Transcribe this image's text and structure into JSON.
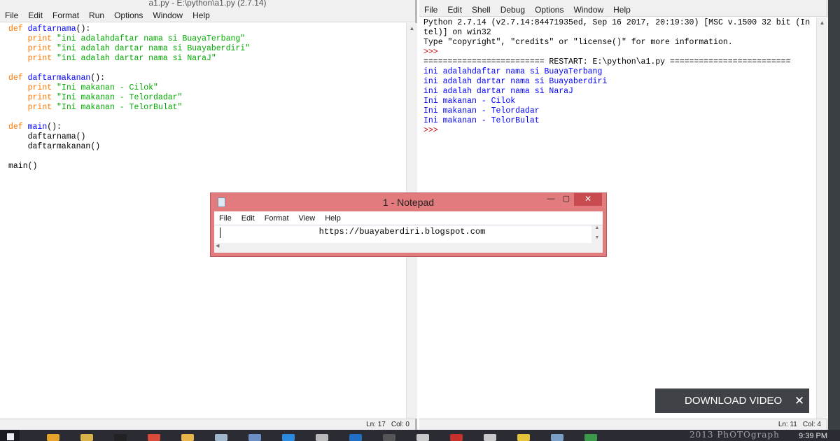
{
  "editor": {
    "title": "a1.py - E:\\python\\a1.py (2.7.14)",
    "menu": [
      "File",
      "Edit",
      "Format",
      "Run",
      "Options",
      "Window",
      "Help"
    ],
    "code": [
      {
        "kw": "def ",
        "fn": "daftarnama",
        "rest": "():"
      },
      {
        "indent": "    ",
        "kw": "print ",
        "str": "\"ini adalahdaftar nama si BuayaTerbang\""
      },
      {
        "indent": "    ",
        "kw": "print ",
        "str": "\"ini adalah dartar nama si Buayaberdiri\""
      },
      {
        "indent": "    ",
        "kw": "print ",
        "str": "\"ini adalah dartar nama si NaraJ\""
      },
      {},
      {
        "kw": "def ",
        "fn": "daftarmakanan",
        "rest": "():"
      },
      {
        "indent": "    ",
        "kw": "print ",
        "str": "\"Ini makanan - Cilok\""
      },
      {
        "indent": "    ",
        "kw": "print ",
        "str": "\"Ini makanan - Telordadar\""
      },
      {
        "indent": "    ",
        "kw": "print ",
        "str": "\"Ini makanan - TelorBulat\""
      },
      {},
      {
        "kw": "def ",
        "fn": "main",
        "rest": "():"
      },
      {
        "indent": "    ",
        "rest": "daftarnama()"
      },
      {
        "indent": "    ",
        "rest": "daftarmakanan()"
      },
      {},
      {
        "rest": "main()"
      }
    ],
    "status_ln": "Ln: 17",
    "status_col": "Col: 0"
  },
  "shell": {
    "menu": [
      "File",
      "Edit",
      "Shell",
      "Debug",
      "Options",
      "Window",
      "Help"
    ],
    "lines": [
      {
        "t": "Python 2.7.14 (v2.7.14:84471935ed, Sep 16 2017, 20:19:30) [MSC v.1500 32 bit (In",
        "c": "out"
      },
      {
        "t": "tel)] on win32",
        "c": "out"
      },
      {
        "t": "Type \"copyright\", \"credits\" or \"license()\" for more information.",
        "c": "out"
      },
      {
        "t": ">>> ",
        "c": "prompt"
      },
      {
        "t": "========================= RESTART: E:\\python\\a1.py =========================",
        "c": "out"
      },
      {
        "t": "ini adalahdaftar nama si BuayaTerbang",
        "c": "blue"
      },
      {
        "t": "ini adalah dartar nama si Buayaberdiri",
        "c": "blue"
      },
      {
        "t": "ini adalah dartar nama si NaraJ",
        "c": "blue"
      },
      {
        "t": "Ini makanan - Cilok",
        "c": "blue"
      },
      {
        "t": "Ini makanan - Telordadar",
        "c": "blue"
      },
      {
        "t": "Ini makanan - TelorBulat",
        "c": "blue"
      },
      {
        "t": ">>> ",
        "c": "prompt"
      }
    ],
    "status_ln": "Ln: 11",
    "status_col": "Col: 4"
  },
  "notepad": {
    "title": "1 - Notepad",
    "menu": [
      "File",
      "Edit",
      "Format",
      "View",
      "Help"
    ],
    "content": "https://buayaberdiri.blogspot.com",
    "accent": "#e27b7d"
  },
  "download_banner": {
    "label": "DOWNLOAD VIDEO",
    "close": "✕"
  },
  "taskbar": {
    "clock": "9:39 PM",
    "watermark": "2013 PhOTOgraph",
    "items": [
      {
        "name": "file-explorer-icon",
        "color": "#e6a42a"
      },
      {
        "name": "folder-icon",
        "color": "#d9b24a"
      },
      {
        "name": "terminal-icon",
        "color": "#222222"
      },
      {
        "name": "chrome-icon",
        "color": "#d84a3a"
      },
      {
        "name": "paint-icon",
        "color": "#e8b54a"
      },
      {
        "name": "notepad-icon",
        "color": "#9fb6cc"
      },
      {
        "name": "keyboard-icon",
        "color": "#6c8fc8"
      },
      {
        "name": "ie-icon",
        "color": "#2b8be0"
      },
      {
        "name": "disk-icon",
        "color": "#b9b9b9"
      },
      {
        "name": "shield-icon",
        "color": "#1f6fc4"
      },
      {
        "name": "app-icon",
        "color": "#555555"
      },
      {
        "name": "tool-icon",
        "color": "#c8c8c8"
      },
      {
        "name": "red-app-icon",
        "color": "#c9302c"
      },
      {
        "name": "doc-icon",
        "color": "#c9c9c9"
      },
      {
        "name": "help-icon",
        "color": "#e5c43a"
      },
      {
        "name": "monitor-icon",
        "color": "#7aa0c8"
      },
      {
        "name": "spreadsheet-icon",
        "color": "#3a9a4a"
      }
    ]
  }
}
